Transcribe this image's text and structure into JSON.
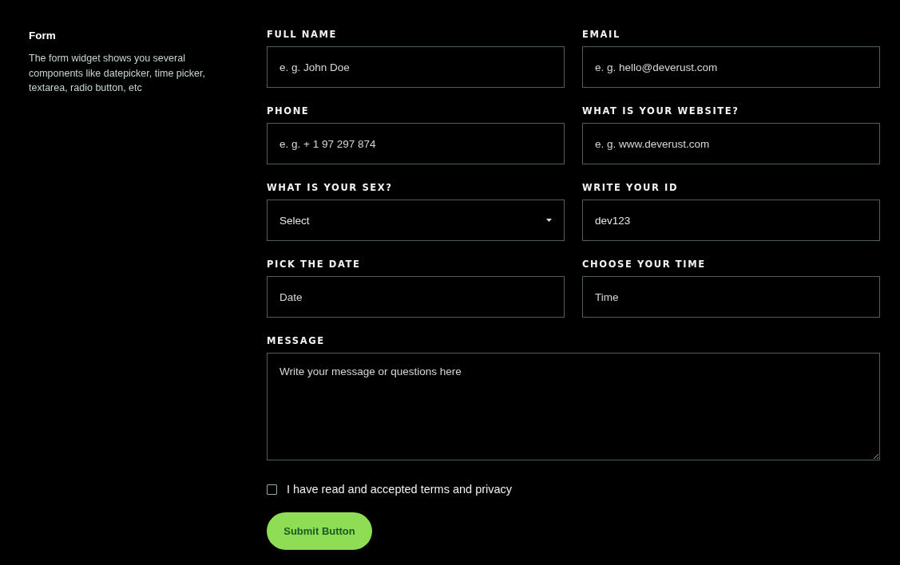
{
  "intro": {
    "title": "Form",
    "description": "The form widget shows you several components like datepicker, time picker, textarea, radio button, etc"
  },
  "fields": [
    {
      "kind": "text",
      "label": "FULL NAME",
      "placeholder": "e. g. John Doe"
    },
    {
      "kind": "text",
      "label": "EMAIL",
      "placeholder": "e. g. hello@deverust.com"
    },
    {
      "kind": "text",
      "label": "PHONE",
      "placeholder": "e. g. + 1 97 297 874"
    },
    {
      "kind": "text",
      "label": "WHAT IS YOUR WEBSITE?",
      "placeholder": "e. g. www.deverust.com"
    },
    {
      "kind": "select",
      "label": "WHAT IS YOUR SEX?",
      "value": "Select"
    },
    {
      "kind": "text",
      "label": "WRITE YOUR ID",
      "value": "dev123"
    },
    {
      "kind": "text",
      "label": "PICK THE DATE",
      "placeholder": "Date"
    },
    {
      "kind": "text",
      "label": "CHOOSE YOUR TIME",
      "placeholder": "Time"
    },
    {
      "kind": "textarea",
      "label": "MESSAGE",
      "placeholder": "Write your message or questions here"
    }
  ],
  "agreement": {
    "label": "I have read and accepted terms and privacy",
    "checked": false
  },
  "submit": {
    "label": "Submit Button"
  }
}
